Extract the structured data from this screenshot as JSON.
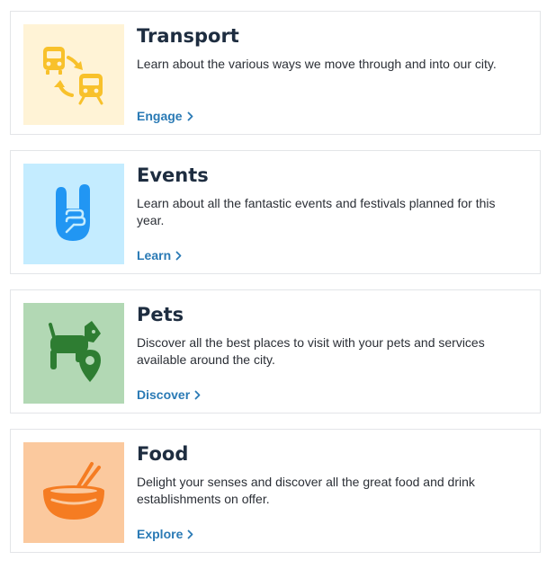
{
  "cards": [
    {
      "title": "Transport",
      "description": "Learn about the various ways we move through and into our city.",
      "link_label": "Engage",
      "icon": "bus-train-icon",
      "thumb_bg": "#fff3d6",
      "icon_color": "#f8c12b"
    },
    {
      "title": "Events",
      "description": "Learn about all the fantastic events and festivals planned for this year.",
      "link_label": "Learn",
      "icon": "rock-hand-icon",
      "thumb_bg": "#c4ecff",
      "icon_color": "#2196f3"
    },
    {
      "title": "Pets",
      "description": "Discover all the best places to visit with your pets and services available around the city.",
      "link_label": "Discover",
      "icon": "dog-location-icon",
      "thumb_bg": "#b2d8b4",
      "icon_color": "#2e7d32"
    },
    {
      "title": "Food",
      "description": "Delight your senses and discover all the great food and drink establishments on offer.",
      "link_label": "Explore",
      "icon": "bowl-chopsticks-icon",
      "thumb_bg": "#fbc99e",
      "icon_color": "#f57c22"
    }
  ],
  "link_color": "#2a7ab5"
}
